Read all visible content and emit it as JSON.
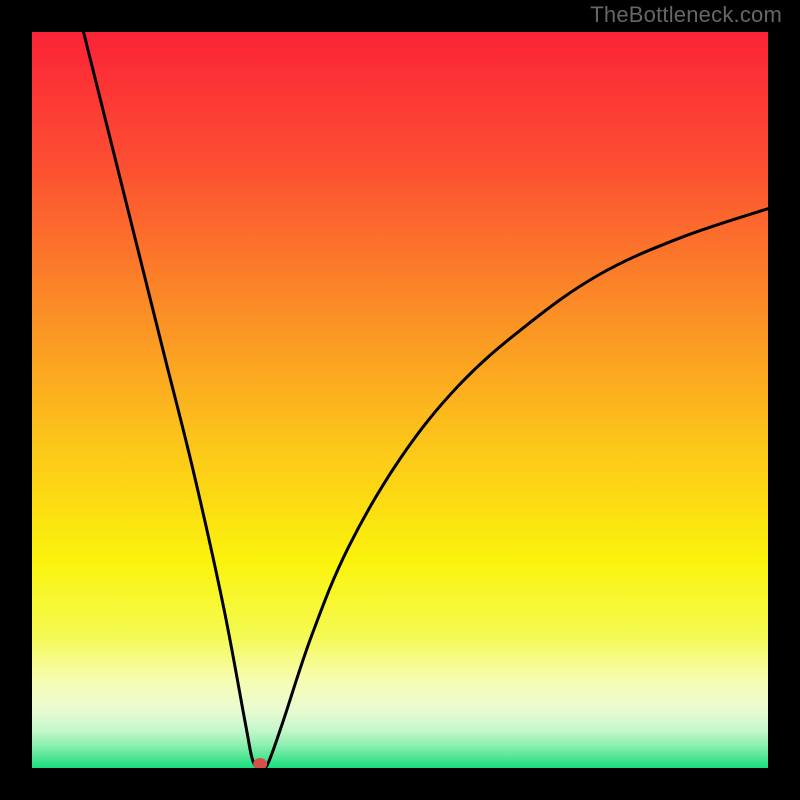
{
  "watermark": "TheBottleneck.com",
  "chart_data": {
    "type": "line",
    "title": "",
    "xlabel": "",
    "ylabel": "",
    "xlim": [
      0,
      100
    ],
    "ylim": [
      0,
      100
    ],
    "min_marker": {
      "x": 31,
      "y": 0,
      "color": "#d4514a"
    },
    "gradient_stops": [
      {
        "pct": 0,
        "color": "#fb2337"
      },
      {
        "pct": 18,
        "color": "#fc4f32"
      },
      {
        "pct": 38,
        "color": "#fb8e26"
      },
      {
        "pct": 55,
        "color": "#fcc31a"
      },
      {
        "pct": 72,
        "color": "#fbf30c"
      },
      {
        "pct": 82,
        "color": "#f4fa52"
      },
      {
        "pct": 88,
        "color": "#f6fcb1"
      },
      {
        "pct": 92,
        "color": "#ebfbd1"
      },
      {
        "pct": 95,
        "color": "#c2f7cb"
      },
      {
        "pct": 97,
        "color": "#88efae"
      },
      {
        "pct": 100,
        "color": "#1ade7e"
      }
    ],
    "curve_points": [
      {
        "x": 7,
        "y": 100
      },
      {
        "x": 10,
        "y": 88
      },
      {
        "x": 14,
        "y": 72
      },
      {
        "x": 18,
        "y": 56
      },
      {
        "x": 22,
        "y": 40
      },
      {
        "x": 26,
        "y": 22
      },
      {
        "x": 29,
        "y": 6
      },
      {
        "x": 30,
        "y": 1
      },
      {
        "x": 31,
        "y": 0
      },
      {
        "x": 32,
        "y": 0.5
      },
      {
        "x": 34,
        "y": 6
      },
      {
        "x": 38,
        "y": 18
      },
      {
        "x": 43,
        "y": 30
      },
      {
        "x": 50,
        "y": 42
      },
      {
        "x": 58,
        "y": 52
      },
      {
        "x": 67,
        "y": 60
      },
      {
        "x": 77,
        "y": 67
      },
      {
        "x": 88,
        "y": 72
      },
      {
        "x": 100,
        "y": 76
      }
    ]
  }
}
